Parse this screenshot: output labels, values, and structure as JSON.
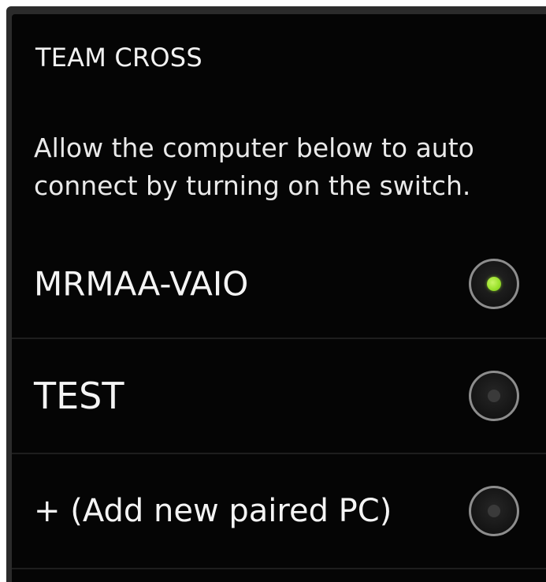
{
  "section": {
    "title": "TEAM CROSS",
    "description_line1": "Allow the computer below to auto",
    "description_line2": "connect by turning on the switch."
  },
  "computers": [
    {
      "label": "MRMAA-VAIO",
      "selected": true
    },
    {
      "label": "TEST",
      "selected": false
    },
    {
      "label": "+ (Add new paired PC)",
      "selected": false
    }
  ],
  "colors": {
    "background": "#050505",
    "text": "#f4f4f4",
    "radio_on": "#9be22d",
    "radio_ring": "#8d8d8d"
  }
}
